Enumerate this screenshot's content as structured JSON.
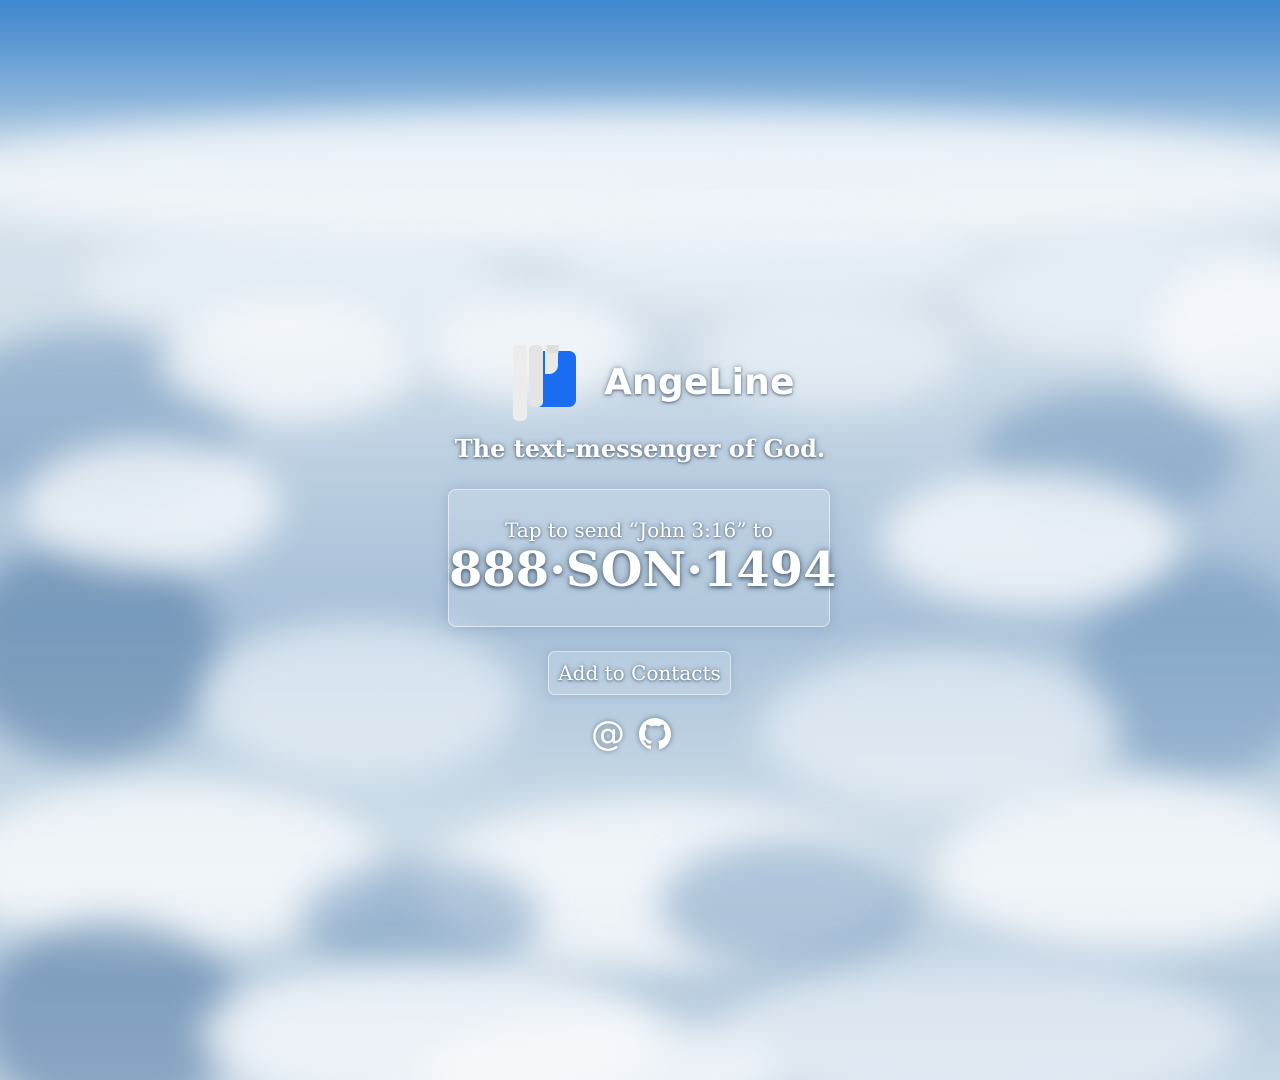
{
  "brand": {
    "name": "AngeLine",
    "logo_icon": "angeline-logo-icon",
    "logo_colors": {
      "light": "#eaeaea",
      "accent": "#1a6cf0"
    }
  },
  "tagline": "The text-messenger of God.",
  "send": {
    "hint": "Tap to send “John 3:16” to",
    "number": "888·SON·1494"
  },
  "contacts_button": {
    "label": "Add to Contacts"
  },
  "links": [
    {
      "icon": "at-sign-icon",
      "glyph": "@"
    },
    {
      "icon": "github-icon"
    }
  ]
}
